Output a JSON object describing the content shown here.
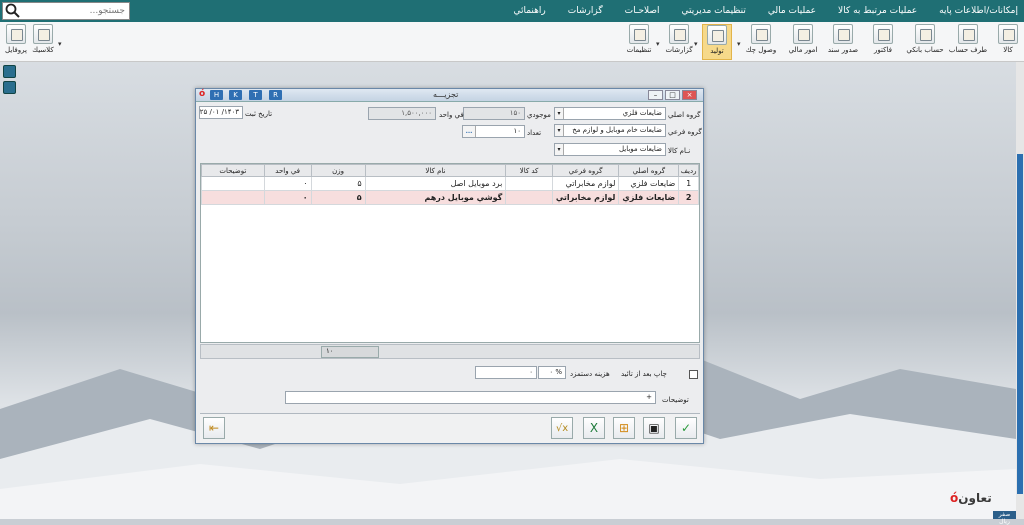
{
  "menu": {
    "items": [
      "إمكانات/اطلاعات پايه",
      "عمليات مرتبط به كالا",
      "عمليات مالي",
      "تنظيمات مديريتي",
      "اصلاحـات",
      "گزارشات",
      "راهنمائي"
    ]
  },
  "search": {
    "placeholder": "جستجو..."
  },
  "toolbar": {
    "items": [
      "كالا",
      "طرف حساب",
      "حساب بانكي",
      "فاكتور",
      "صدور سند",
      "امور مالي",
      "وصول چك",
      "توليد",
      "گزارشات",
      "تنظيمات"
    ],
    "left_items": [
      "كلاسيك",
      "پروفايل"
    ]
  },
  "window": {
    "title": "تجزيـــه",
    "badges": [
      "H",
      "K",
      "T",
      "R"
    ],
    "date_label": "تاريخ ثبت",
    "date_value": "۱۴۰۳/ ۰۱/ ۲۵",
    "main_group_label": "گروه اصلي",
    "main_group_value": "ضايعات فلزي",
    "sub_group_label": "گروه فرعي",
    "sub_group_value": "ضايعات خام موبايل و لوازم مخ",
    "item_name_label": "نـام كالا",
    "item_name_value": "ضايعات موبايل",
    "stock_label": "موجودي",
    "stock_value": "۱۵۰",
    "unit_price_label": "في واحد",
    "unit_price_value": "۱,۵۰۰,۰۰۰",
    "count_label": "تعداد",
    "count_value": "۱۰",
    "ellipsis": "...",
    "table": {
      "headers": [
        "رديف",
        "گروه اصلي",
        "گروه فرعي",
        "كد كالا",
        "نام كالا",
        "وزن",
        "في واحد",
        "توضيحات"
      ],
      "rows": [
        [
          "1",
          "ضايعات فلزي",
          "لوازم مخابراتي",
          "",
          "برد موبايل اصل",
          "۵",
          "۰",
          ""
        ],
        [
          "2",
          "ضايعات فلزي",
          "لوازم مخابراتي",
          "",
          "گوشي موبايل درهم",
          "۵",
          "۰",
          ""
        ]
      ]
    },
    "sum_value": "۱۰",
    "print_after_label": "چاپ بعد از تائيد",
    "wage_label": "هزينه دستمزد",
    "wage_percent": "%",
    "wage_pct_value": "۰",
    "wage_value": "۰",
    "notes_label": "توضيحات",
    "notes_value": "+"
  },
  "brand": {
    "logo": "تعاون",
    "footer": "صفر ريال"
  },
  "colors": {
    "menubar": "#1f6f74",
    "accent": "#2f6fb3",
    "selected_row": "#f7dede"
  }
}
